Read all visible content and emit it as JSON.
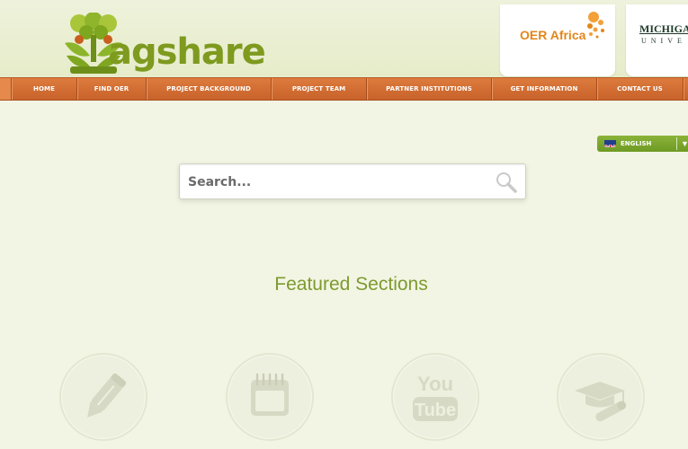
{
  "header": {
    "logo_text": "agshare",
    "partners": [
      {
        "name": "OER Africa"
      },
      {
        "name": "MICHIGAN",
        "sub": "UNIVE"
      }
    ]
  },
  "nav": {
    "items": [
      "HOME",
      "FIND OER",
      "PROJECT BACKGROUND",
      "PROJECT TEAM",
      "PARTNER INSTITUTIONS",
      "GET INFORMATION",
      "CONTACT US"
    ]
  },
  "language": {
    "selected": "ENGLISH"
  },
  "search": {
    "placeholder": "Search..."
  },
  "featured": {
    "title": "Featured Sections",
    "sections": [
      {
        "icon": "pencil-icon"
      },
      {
        "icon": "calendar-icon"
      },
      {
        "icon": "youtube-icon",
        "text_top": "You",
        "text_bottom": "Tube"
      },
      {
        "icon": "graduation-cap-icon"
      }
    ]
  },
  "colors": {
    "background": "#f2f5e3",
    "nav_orange": "#cf6a31",
    "brand_green": "#7e9a1f",
    "oer_orange": "#e2861b"
  }
}
